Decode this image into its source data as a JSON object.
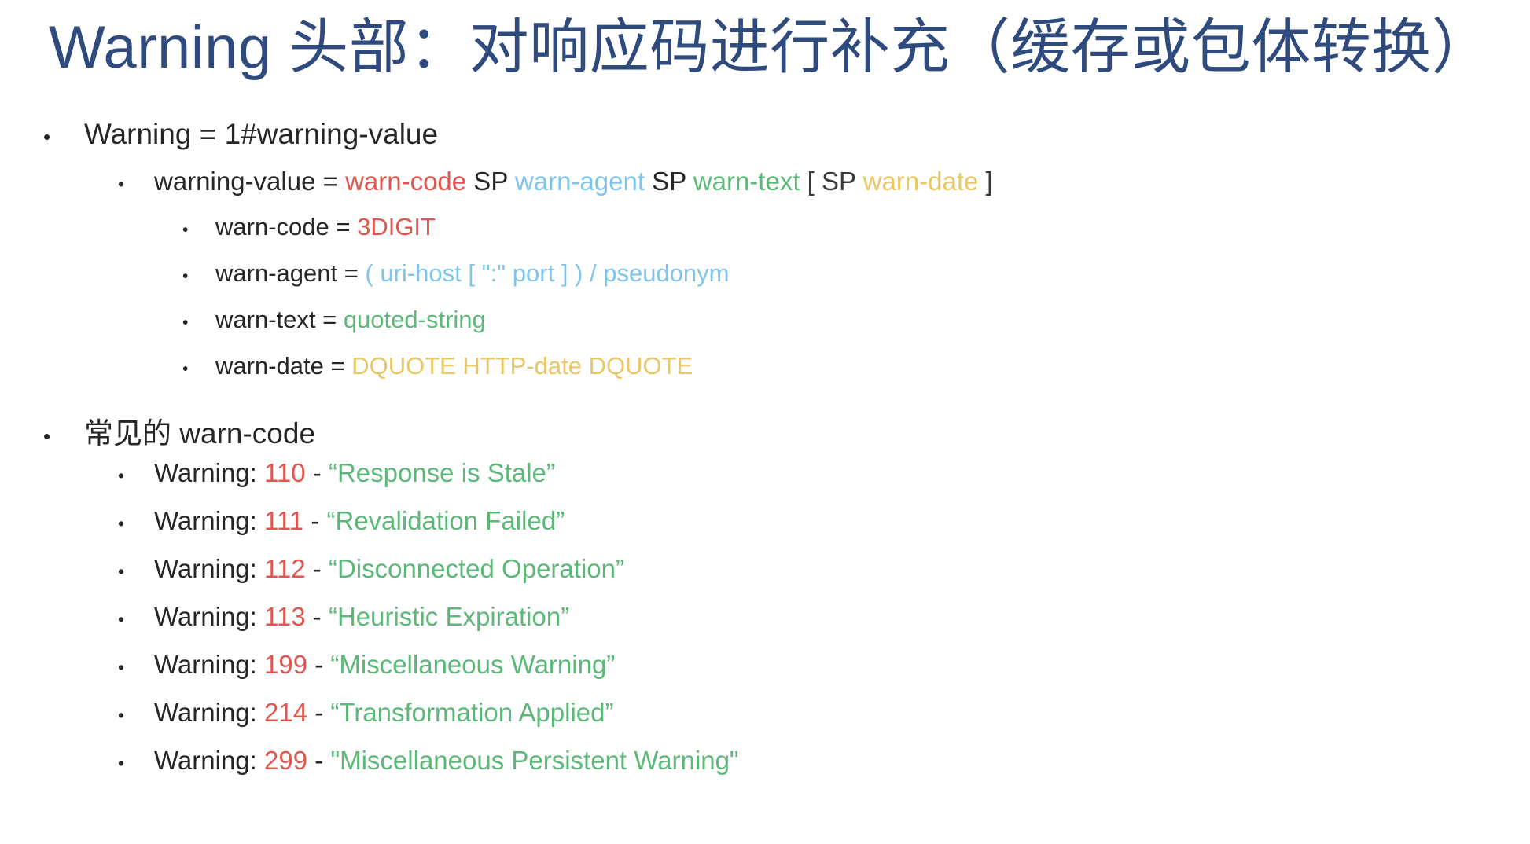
{
  "slide": {
    "title": "Warning 头部：对响应码进行补充（缓存或包体转换）",
    "title_color": "#2f4a7c",
    "background": "#ffffff",
    "bullet_glyph": "•"
  },
  "palette": {
    "default_text": "#262626",
    "warn_code_red": "#e0564f",
    "warn_agent_blue": "#7fc4ea",
    "warn_text_green": "#5cb878",
    "warn_date_gold": "#e9c767",
    "bracket_dark": "#3b3b3b"
  },
  "abnf": {
    "rule_top": {
      "label": "Warning = 1#warning-value"
    },
    "rule_value": {
      "prefix": "warning-value = ",
      "warn_code": "warn-code",
      "sp1": " SP ",
      "warn_agent": "warn-agent",
      "sp2": " SP ",
      "warn_text": "warn-text",
      "bracket_open": " [ SP ",
      "warn_date": "warn-date",
      "bracket_close": " ]"
    },
    "definitions": [
      {
        "name": "warn-code",
        "prefix": "warn-code = ",
        "value": "3DIGIT",
        "color_key": "red"
      },
      {
        "name": "warn-agent",
        "prefix": "warn-agent = ",
        "value": "( uri-host [ \":\" port ] ) / pseudonym",
        "color_key": "blue"
      },
      {
        "name": "warn-text",
        "prefix": "warn-text = ",
        "value": "quoted-string",
        "color_key": "green"
      },
      {
        "name": "warn-date",
        "prefix": "warn-date = ",
        "value": "DQUOTE HTTP-date DQUOTE",
        "color_key": "gold"
      }
    ]
  },
  "common_codes": {
    "heading": "常见的 warn-code",
    "items": [
      {
        "prefix": "Warning: ",
        "code": "110",
        "dash": " - ",
        "text": "“Response is Stale”"
      },
      {
        "prefix": "Warning: ",
        "code": "111",
        "dash": " - ",
        "text": "“Revalidation Failed”"
      },
      {
        "prefix": "Warning: ",
        "code": "112",
        "dash": " - ",
        "text": "“Disconnected Operation”"
      },
      {
        "prefix": "Warning: ",
        "code": "113",
        "dash": " - ",
        "text": "“Heuristic Expiration”"
      },
      {
        "prefix": "Warning: ",
        "code": "199",
        "dash": " - ",
        "text": "“Miscellaneous Warning”"
      },
      {
        "prefix": "Warning: ",
        "code": "214",
        "dash": " - ",
        "text": "“Transformation Applied”"
      },
      {
        "prefix": "Warning: ",
        "code": "299",
        "dash": " - ",
        "text": "\"Miscellaneous Persistent Warning\""
      }
    ]
  }
}
